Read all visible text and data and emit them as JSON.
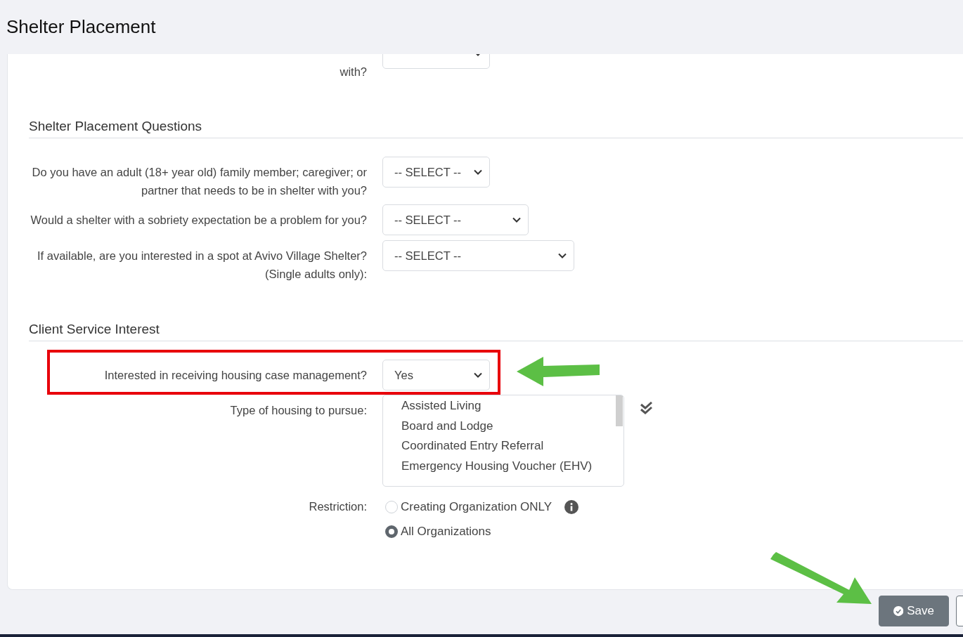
{
  "header": {
    "title": "Shelter Placement"
  },
  "top_question": {
    "label": "with?"
  },
  "sections": [
    {
      "title": "Shelter Placement Questions",
      "questions": [
        {
          "kind": "select",
          "label": "Do you have an adult (18+ year old) family member; caregiver; or partner that needs to be in shelter with you?",
          "value": "-- SELECT --",
          "highlighted": false
        },
        {
          "kind": "select",
          "label": "Would a shelter with a sobriety expectation be a problem for you?",
          "value": "-- SELECT --",
          "highlighted": false
        },
        {
          "kind": "select",
          "label": "If available, are you interested in a spot at Avivo Village Shelter? (Single adults only):",
          "value": "-- SELECT --",
          "highlighted": false
        }
      ]
    },
    {
      "title": "Client Service Interest",
      "questions": [
        {
          "kind": "select",
          "label": "Interested in receiving housing case management?",
          "value": "Yes",
          "highlighted": true
        },
        {
          "kind": "listbox",
          "label": "Type of housing to pursue:",
          "options": [
            "Assisted Living",
            "Board and Lodge",
            "Coordinated Entry Referral",
            "Emergency Housing Voucher (EHV)"
          ]
        },
        {
          "kind": "radio",
          "label": "Restriction:",
          "options": [
            {
              "label": "Creating Organization ONLY",
              "selected": false,
              "info": true
            },
            {
              "label": "All Organizations",
              "selected": true,
              "info": false
            }
          ]
        }
      ]
    }
  ],
  "footer": {
    "buttons": [
      {
        "kind": "primary",
        "label": "Save",
        "highlighted": true
      },
      {
        "kind": "outline"
      }
    ]
  }
}
